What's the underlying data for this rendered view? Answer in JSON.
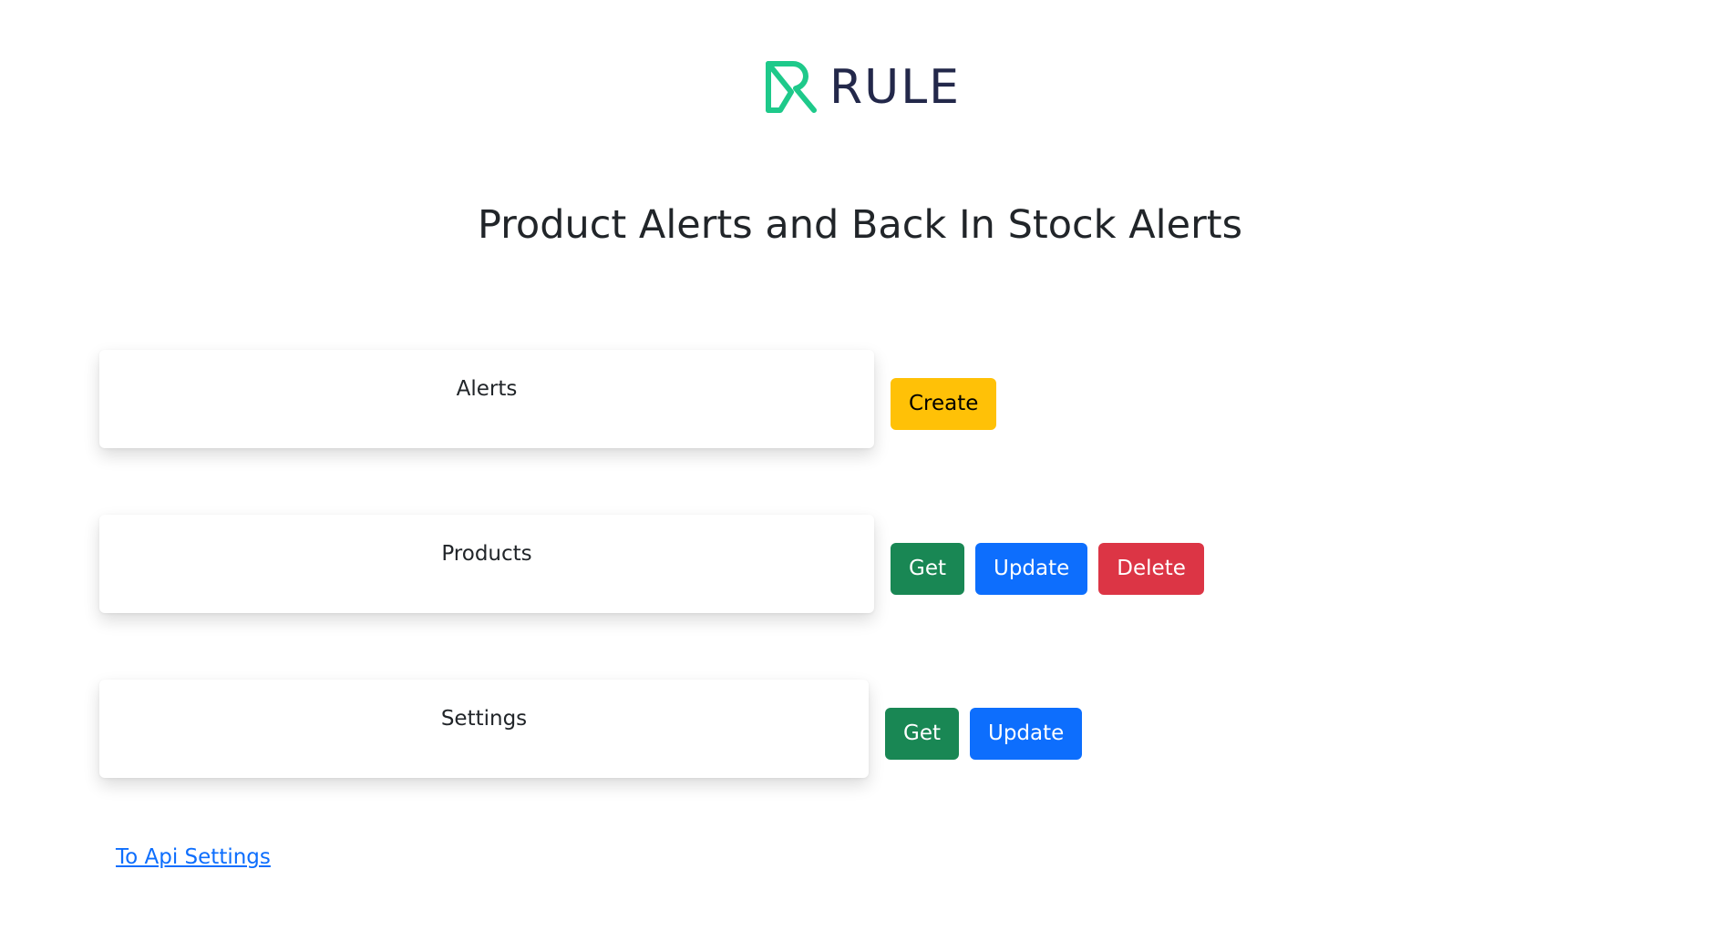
{
  "logo": {
    "wordmark": "RULE",
    "colors": {
      "mark": "#1ec98a",
      "text": "#23284a"
    }
  },
  "title": "Product Alerts and Back In Stock Alerts",
  "sections": {
    "alerts": {
      "label": "Alerts",
      "buttons": {
        "create": "Create"
      }
    },
    "products": {
      "label": "Products",
      "buttons": {
        "get": "Get",
        "update": "Update",
        "delete": "Delete"
      }
    },
    "settings": {
      "label": "Settings",
      "buttons": {
        "get": "Get",
        "update": "Update"
      }
    }
  },
  "link": {
    "api_settings": "To Api Settings"
  },
  "colors": {
    "warning": "#ffc107",
    "success": "#198754",
    "primary": "#0d6efd",
    "danger": "#dc3545"
  }
}
